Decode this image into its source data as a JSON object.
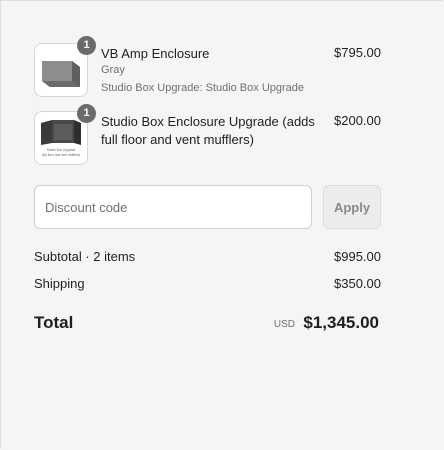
{
  "items": [
    {
      "name": "VB Amp Enclosure",
      "variant": "Gray",
      "option": "Studio Box Upgrade: Studio Box Upgrade",
      "price": "$795.00",
      "quantity": "1",
      "thumbnail_icon": "gray-amp-enclosure-image"
    },
    {
      "name": "Studio Box Enclosure Upgrade (adds full floor and vent mufflers)",
      "price": "$200.00",
      "quantity": "1",
      "thumbnail_icon": "studio-box-upgrade-image",
      "thumbnail_caption_1": "Studio Box Upgrade",
      "thumbnail_caption_2": "(full floor and vent mufflers)"
    }
  ],
  "discount": {
    "placeholder": "Discount code",
    "apply_label": "Apply"
  },
  "subtotal": {
    "label": "Subtotal · 2 items",
    "value": "$995.00"
  },
  "shipping": {
    "label": "Shipping",
    "value": "$350.00"
  },
  "total": {
    "label": "Total",
    "currency": "USD",
    "value": "$1,345.00"
  },
  "colors": {
    "background": "#f5f5f5",
    "badge": "#6b6b6b",
    "muted_text": "#707070"
  }
}
